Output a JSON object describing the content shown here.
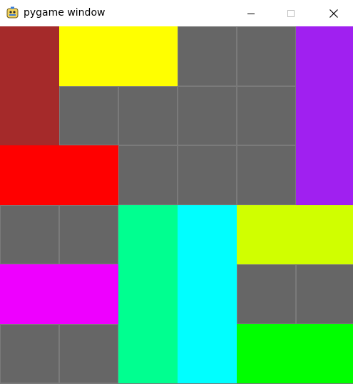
{
  "window": {
    "title": "pygame window",
    "app_icon": "pygame-snake-icon",
    "controls": {
      "minimize_icon": "minimize-icon",
      "maximize_icon": "maximize-icon",
      "close_icon": "close-icon"
    }
  },
  "board": {
    "columns": 6,
    "rows": 6,
    "grid_line_color": "#7a7a7a",
    "empty_color": "#666666",
    "blocks": [
      {
        "name": "block-brown",
        "color": "#a52a2a",
        "col": 0,
        "row": 0,
        "w": 1,
        "h": 2
      },
      {
        "name": "block-yellow",
        "color": "#ffff00",
        "col": 1,
        "row": 0,
        "w": 2,
        "h": 1
      },
      {
        "name": "block-purple",
        "color": "#a020f0",
        "col": 5,
        "row": 0,
        "w": 1,
        "h": 3
      },
      {
        "name": "block-red",
        "color": "#ff0000",
        "col": 0,
        "row": 2,
        "w": 2,
        "h": 1
      },
      {
        "name": "block-spring-green",
        "color": "#00ff90",
        "col": 2,
        "row": 3,
        "w": 1,
        "h": 3
      },
      {
        "name": "block-cyan",
        "color": "#00ffff",
        "col": 3,
        "row": 3,
        "w": 1,
        "h": 3
      },
      {
        "name": "block-lime-yellow",
        "color": "#d0ff00",
        "col": 4,
        "row": 3,
        "w": 2,
        "h": 1
      },
      {
        "name": "block-magenta",
        "color": "#ee00ff",
        "col": 0,
        "row": 4,
        "w": 2,
        "h": 1
      },
      {
        "name": "block-green",
        "color": "#00ff00",
        "col": 4,
        "row": 5,
        "w": 2,
        "h": 1
      }
    ]
  }
}
